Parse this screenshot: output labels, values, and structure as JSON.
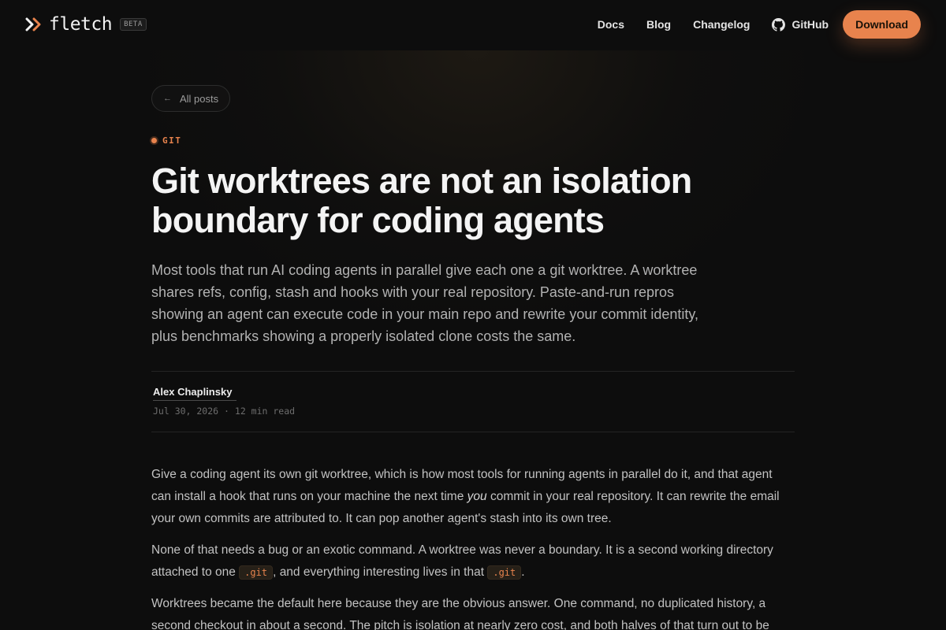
{
  "header": {
    "brand": "fletch",
    "badge": "BETA",
    "nav": [
      "Docs",
      "Blog",
      "Changelog",
      "GitHub"
    ],
    "cta": "Download"
  },
  "article": {
    "back_label": "All posts",
    "tag": "GIT",
    "title": "Git worktrees are not an isolation boundary for coding agents",
    "lede": "Most tools that run AI coding agents in parallel give each one a git worktree. A worktree shares refs, config, stash and hooks with your real repository. Paste-and-run repros showing an agent can execute code in your main repo and rewrite your commit identity, plus benchmarks showing a properly isolated clone costs the same.",
    "author": "Alex Chaplinsky",
    "date": "Jul 30, 2026",
    "separator": "·",
    "read_time": "12 min read",
    "p1_a": "Give a coding agent its own git worktree, which is how most tools for running agents in parallel do it, and that agent can install a hook that runs on your machine the next time ",
    "p1_em": "you",
    "p1_b": " commit in your real repository. It can rewrite the email your own commits are attributed to. It can pop another agent's stash into its own tree.",
    "p2_a": "None of that needs a bug or an exotic command. A worktree was never a boundary. It is a second working directory attached to one ",
    "p2_code1": ".git",
    "p2_b": ", and everything interesting lives in that ",
    "p2_code2": ".git",
    "p2_c": ".",
    "p3": "Worktrees became the default here because they are the obvious answer. One command, no duplicated history, a second checkout in about a second. The pitch is isolation at nearly zero cost, and both halves of that turn out to be"
  },
  "colors": {
    "accent": "#e8834d",
    "background": "#0d0d0d"
  },
  "icons": {
    "logo": "chevrons-right-icon",
    "github": "github-icon",
    "back": "arrow-left-icon",
    "tag": "dot-icon"
  }
}
